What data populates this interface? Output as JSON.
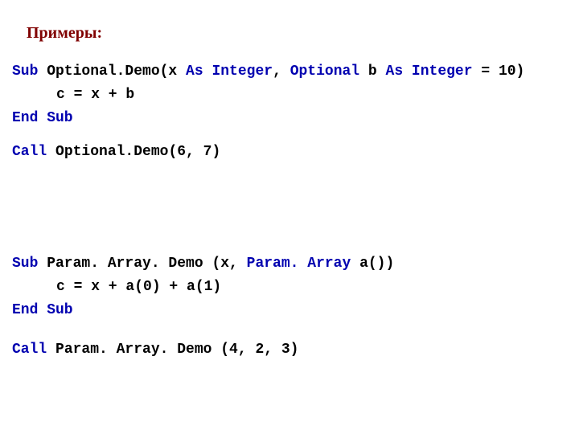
{
  "title": "Примеры:",
  "b1": {
    "l1": {
      "kw1": "Sub",
      "t1": " Optional.Demo(x ",
      "kw2": "As Integer",
      "t2": ", ",
      "kw3": "Optional",
      "t3": " b ",
      "kw4": "As Integer",
      "t4": " = 10)"
    },
    "l2": "c = x + b",
    "l3": {
      "kw1": "End Sub"
    },
    "l4": {
      "kw1": "Call",
      "t1": " Optional.Demo(6, 7)"
    }
  },
  "b2": {
    "l1": {
      "kw1": "Sub",
      "t1": " Param. Array. Demo (x, ",
      "kw2": "Param. Array",
      "t2": " a())"
    },
    "l2": "c = x + a(0) + a(1)",
    "l3": {
      "kw1": "End Sub"
    },
    "l4": {
      "kw1": "Call",
      "t1": " Param. Array. Demo (4, 2, 3)"
    }
  }
}
